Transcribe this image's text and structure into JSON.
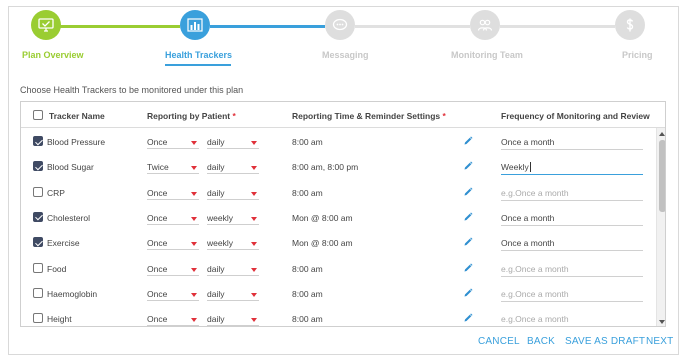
{
  "stepper": {
    "steps": [
      {
        "label": "Plan Overview",
        "state": "done",
        "icon": "monitor-check-icon"
      },
      {
        "label": "Health Trackers",
        "state": "active",
        "icon": "bar-chart-icon"
      },
      {
        "label": "Messaging",
        "state": "pending",
        "icon": "chat-bubble-icon"
      },
      {
        "label": "Monitoring Team",
        "state": "pending",
        "icon": "team-icon"
      },
      {
        "label": "Pricing",
        "state": "pending",
        "icon": "dollar-icon"
      }
    ],
    "colors": {
      "done": "#9acd32",
      "active": "#3aa0dc",
      "pending": "#d9d9d9",
      "pending_text": "#c8c8c8"
    }
  },
  "intro_text": "Choose Health Trackers to be monitored under this plan",
  "table": {
    "headers": {
      "tracker_name": "Tracker Name",
      "reporting_by_patient": "Reporting by Patient",
      "reporting_time": "Reporting Time & Reminder Settings",
      "frequency": "Frequency of Monitoring and Review",
      "required_marker": "*"
    },
    "placeholder": "e.g.Once a month",
    "rows": [
      {
        "name": "Blood Pressure",
        "checked": true,
        "times": "Once",
        "period": "daily",
        "reporting_time": "8:00 am",
        "frequency": "Once a month"
      },
      {
        "name": "Blood Sugar",
        "checked": true,
        "times": "Twice",
        "period": "daily",
        "reporting_time": "8:00 am, 8:00 pm",
        "frequency": "Weekly"
      },
      {
        "name": "CRP",
        "checked": false,
        "times": "Once",
        "period": "daily",
        "reporting_time": "8:00 am",
        "frequency": ""
      },
      {
        "name": "Cholesterol",
        "checked": true,
        "times": "Once",
        "period": "weekly",
        "reporting_time": "Mon @ 8:00 am",
        "frequency": "Once a month"
      },
      {
        "name": "Exercise",
        "checked": true,
        "times": "Once",
        "period": "weekly",
        "reporting_time": "Mon @ 8:00 am",
        "frequency": "Once a month"
      },
      {
        "name": "Food",
        "checked": false,
        "times": "Once",
        "period": "daily",
        "reporting_time": "8:00 am",
        "frequency": ""
      },
      {
        "name": "Haemoglobin",
        "checked": false,
        "times": "Once",
        "period": "daily",
        "reporting_time": "8:00 am",
        "frequency": ""
      },
      {
        "name": "Height",
        "checked": false,
        "times": "Once",
        "period": "daily",
        "reporting_time": "8:00 am",
        "frequency": ""
      }
    ],
    "active_row": 1
  },
  "footer": {
    "cancel": "CANCEL",
    "back": "BACK",
    "save_draft": "SAVE AS DRAFT",
    "next": "NEXT"
  }
}
